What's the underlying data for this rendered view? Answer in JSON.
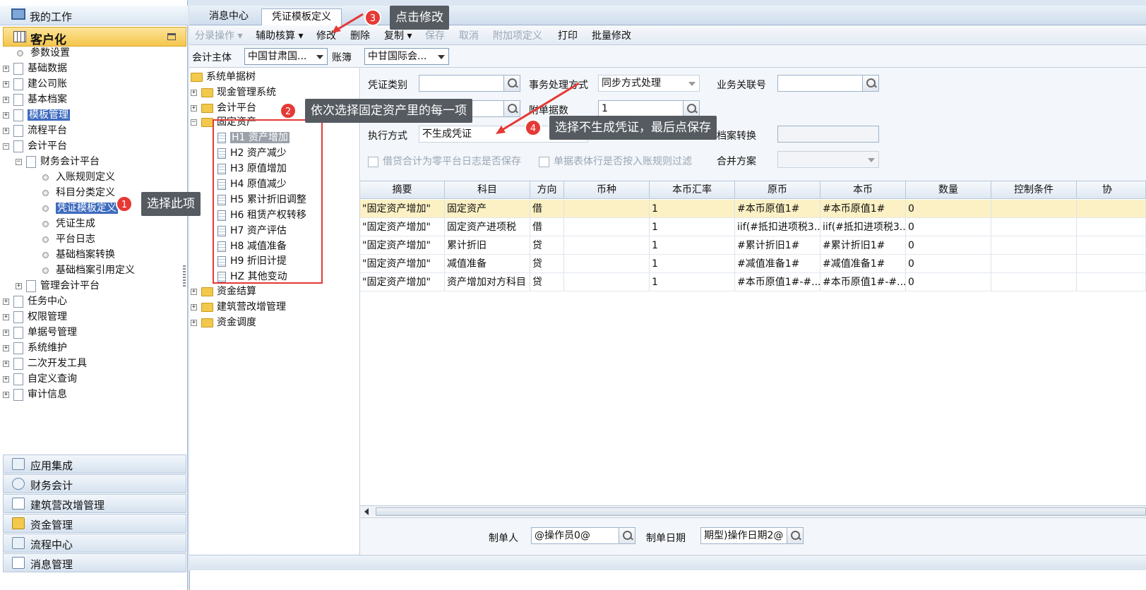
{
  "left_panel": {
    "header": "我的工作",
    "section": "客户化",
    "tree": [
      {
        "label": "参数设置"
      },
      {
        "label": "基础数据"
      },
      {
        "label": "建公司账"
      },
      {
        "label": "基本档案"
      },
      {
        "label": "模板管理"
      },
      {
        "label": "流程平台"
      },
      {
        "label": "会计平台"
      },
      {
        "label": "财务会计平台"
      },
      {
        "label": "入账规则定义"
      },
      {
        "label": "科目分类定义"
      },
      {
        "label": "凭证模板定义"
      },
      {
        "label": "凭证生成"
      },
      {
        "label": "平台日志"
      },
      {
        "label": "基础档案转换"
      },
      {
        "label": "基础档案引用定义"
      },
      {
        "label": "管理会计平台"
      },
      {
        "label": "任务中心"
      },
      {
        "label": "权限管理"
      },
      {
        "label": "单据号管理"
      },
      {
        "label": "系统维护"
      },
      {
        "label": "二次开发工具"
      },
      {
        "label": "自定义查询"
      },
      {
        "label": "审计信息"
      }
    ],
    "bottom_nav": [
      "应用集成",
      "财务会计",
      "建筑营改增管理",
      "资金管理",
      "流程中心",
      "消息管理"
    ]
  },
  "tabs": [
    "消息中心",
    "凭证模板定义"
  ],
  "toolbar": {
    "items": [
      "分录操作",
      "辅助核算",
      "修改",
      "删除",
      "复制",
      "保存",
      "取消",
      "附加项定义",
      "打印",
      "批量修改"
    ]
  },
  "filter": {
    "entity_label": "会计主体",
    "entity_value": "中国甘肃国...",
    "book_label": "账簿",
    "book_value": "中甘国际会..."
  },
  "mid_tree": {
    "root": "系统单据树",
    "folders_top": [
      "现金管理系统",
      "会计平台",
      "固定资产"
    ],
    "items": [
      "H1 资产增加",
      "H2 资产减少",
      "H3 原值增加",
      "H4 原值减少",
      "H5 累计折旧调整",
      "H6 租赁产权转移",
      "H7 资产评估",
      "H8 减值准备",
      "H9 折旧计提",
      "HZ 其他变动"
    ],
    "folders_bottom": [
      "资金结算",
      "建筑营改增管理",
      "资金调度"
    ]
  },
  "form": {
    "voucher_type_label": "凭证类别",
    "process_label": "事务处理方式",
    "process_value": "同步方式处理",
    "biz_no_label": "业务关联号",
    "attach_label": "附单据数",
    "attach_value": "1",
    "exec_label": "执行方式",
    "exec_value": "不生成凭证",
    "archive_label": "档案转换",
    "chk1": "借贷合计为零平台日志是否保存",
    "chk2": "单据表体行是否按入账规则过滤",
    "merge_label": "合并方案"
  },
  "grid": {
    "headers": [
      "摘要",
      "科目",
      "方向",
      "币种",
      "本币汇率",
      "原币",
      "本币",
      "数量",
      "控制条件",
      "协"
    ],
    "rows": [
      [
        "\"固定资产增加\"",
        "固定资产",
        "借",
        "",
        "1",
        "#本币原值1#",
        "#本币原值1#",
        "0",
        ""
      ],
      [
        "\"固定资产增加\"",
        "固定资产进项税",
        "借",
        "",
        "1",
        "iif(#抵扣进项税3...",
        "iif(#抵扣进项税3...",
        "0",
        ""
      ],
      [
        "\"固定资产增加\"",
        "累计折旧",
        "贷",
        "",
        "1",
        "#累计折旧1#",
        "#累计折旧1#",
        "0",
        ""
      ],
      [
        "\"固定资产增加\"",
        "减值准备",
        "贷",
        "",
        "1",
        "#减值准备1#",
        "#减值准备1#",
        "0",
        ""
      ],
      [
        "\"固定资产增加\"",
        "资产增加对方科目",
        "贷",
        "",
        "1",
        "#本币原值1#-#...",
        "#本币原值1#-#...",
        "0",
        ""
      ]
    ]
  },
  "bottom": {
    "maker_label": "制单人",
    "maker_value": "@操作员0@",
    "date_label": "制单日期",
    "date_value": "期型)操作日期2@"
  },
  "annotations": {
    "c1": "选择此项",
    "c2": "依次选择固定资产里的每一项",
    "c3": "点击修改",
    "c4": "选择不生成凭证，最后点保存",
    "b1": "1",
    "b2": "2",
    "b3": "3",
    "b4": "4"
  },
  "colors": {
    "accent": "#3d6bbf",
    "highlight": "#f4c64c",
    "annotation_red": "#e53935"
  }
}
